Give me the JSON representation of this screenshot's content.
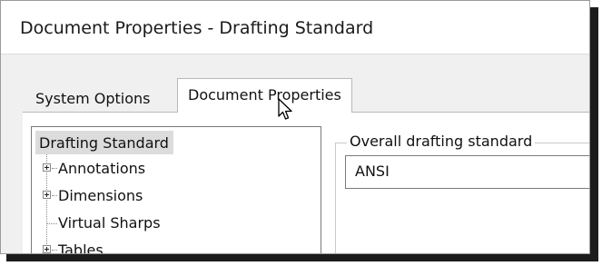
{
  "window": {
    "title": "Document Properties - Drafting Standard"
  },
  "tabs": [
    {
      "label": "System Options",
      "active": false
    },
    {
      "label": "Document Properties",
      "active": true
    }
  ],
  "tree": {
    "selected": "Drafting Standard",
    "items": [
      {
        "label": "Drafting Standard",
        "expandable": false,
        "selected": true
      },
      {
        "label": "Annotations",
        "expandable": true
      },
      {
        "label": "Dimensions",
        "expandable": true
      },
      {
        "label": "Virtual Sharps",
        "expandable": false
      },
      {
        "label": "Tables",
        "expandable": true
      }
    ]
  },
  "overall_standard": {
    "group_label": "Overall drafting standard",
    "value": "ANSI"
  },
  "colors": {
    "selection": "#dcdcdc",
    "tab_background": "#f0f0f0",
    "content_background": "#ffffff",
    "shadow": "#1c1c1c"
  }
}
